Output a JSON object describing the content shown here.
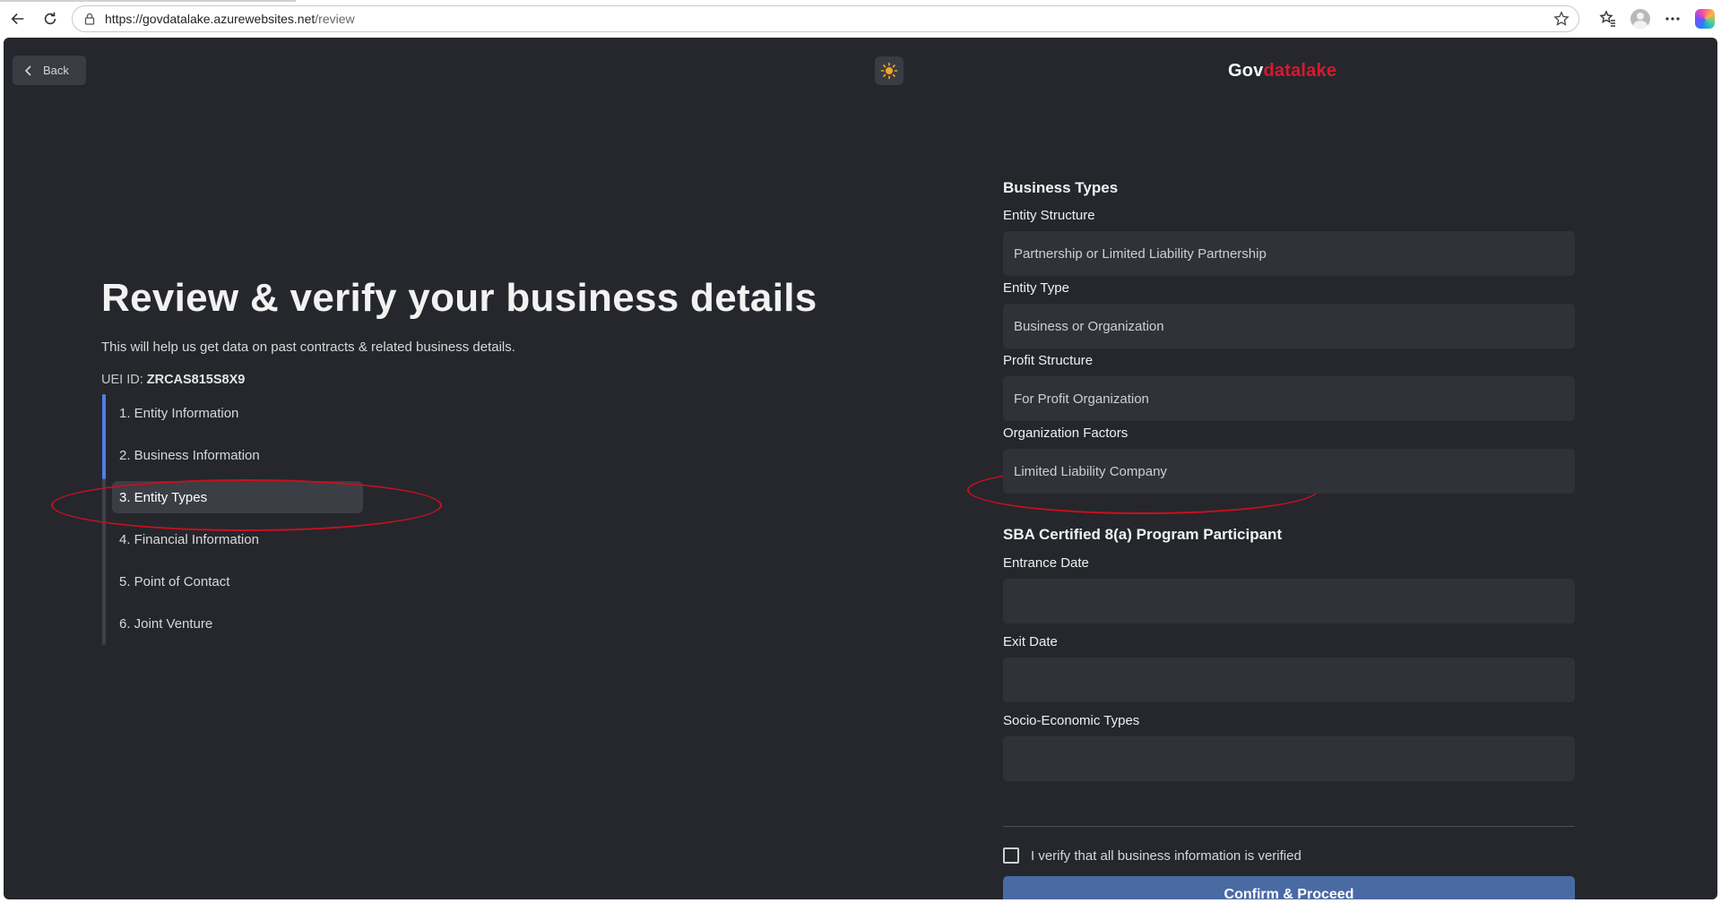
{
  "browser": {
    "url_host": "https://govdatalake.azurewebsites.net",
    "url_path": "/review"
  },
  "header": {
    "back_label": "Back",
    "brand_gov": "Gov",
    "brand_lake": "datalake"
  },
  "hero": {
    "title": "Review & verify your business details",
    "subtitle": "This will help us get data on past contracts & related business details.",
    "uei_label": "UEI ID:",
    "uei_value": "ZRCAS815S8X9"
  },
  "steps": {
    "items": [
      {
        "label": "1. Entity Information"
      },
      {
        "label": "2. Business Information"
      },
      {
        "label": "3. Entity Types"
      },
      {
        "label": "4. Financial Information"
      },
      {
        "label": "5. Point of Contact"
      },
      {
        "label": "6. Joint Venture"
      }
    ],
    "active_index": 2,
    "progress_fraction": 0.34
  },
  "form": {
    "business_types_title": "Business Types",
    "fields": [
      {
        "label": "Entity Structure",
        "value": "Partnership or Limited Liability Partnership"
      },
      {
        "label": "Entity Type",
        "value": "Business or Organization"
      },
      {
        "label": "Profit Structure",
        "value": "For Profit Organization"
      },
      {
        "label": "Organization Factors",
        "value": "Limited Liability Company"
      }
    ],
    "sba_title": "SBA Certified 8(a) Program Participant",
    "sba_fields": [
      {
        "label": "Entrance Date",
        "value": ""
      },
      {
        "label": "Exit Date",
        "value": ""
      },
      {
        "label": "Socio-Economic Types",
        "value": ""
      }
    ],
    "verify_label": "I verify that all business information is verified",
    "verify_checked": false,
    "confirm_label": "Confirm & Proceed"
  },
  "colors": {
    "background": "#25272d",
    "accent": "#4a6aa4",
    "progress": "#4f7fe6",
    "brand_red": "#d8192e",
    "highlight": "#c8101e"
  }
}
